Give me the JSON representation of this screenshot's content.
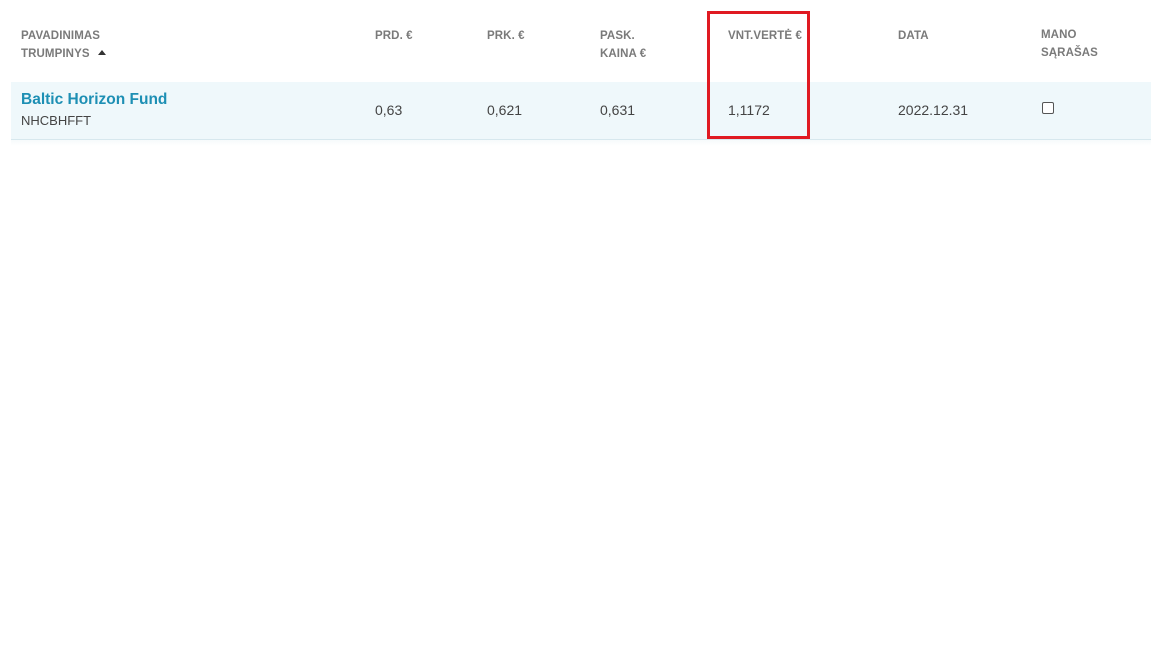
{
  "table": {
    "headers": {
      "name_line1": "PAVADINIMAS",
      "name_line2": "TRUMPINYS",
      "sell": "PRD. €",
      "buy": "PRK. €",
      "last_line1": "PASK.",
      "last_line2": "KAINA €",
      "nav": "VNT.VERTĖ €",
      "date": "DATA",
      "mylist_line1": "MANO",
      "mylist_line2": "SĄRAŠAS"
    },
    "sort": {
      "column": "name",
      "direction": "ascending",
      "icon": "sort-up-triangle-icon"
    },
    "rows": [
      {
        "name": "Baltic Horizon Fund",
        "code": "NHCBHFFT",
        "sell": "0,63",
        "buy": "0,621",
        "last": "0,631",
        "nav": "1,1172",
        "date": "2022.12.31",
        "in_my_list": false
      }
    ]
  },
  "annotation": {
    "highlighted_column": "nav",
    "color": "#e01a22"
  },
  "colors": {
    "link": "#1d8fb4",
    "row_background": "#eff8fb",
    "header_text": "#7a7a7a"
  }
}
